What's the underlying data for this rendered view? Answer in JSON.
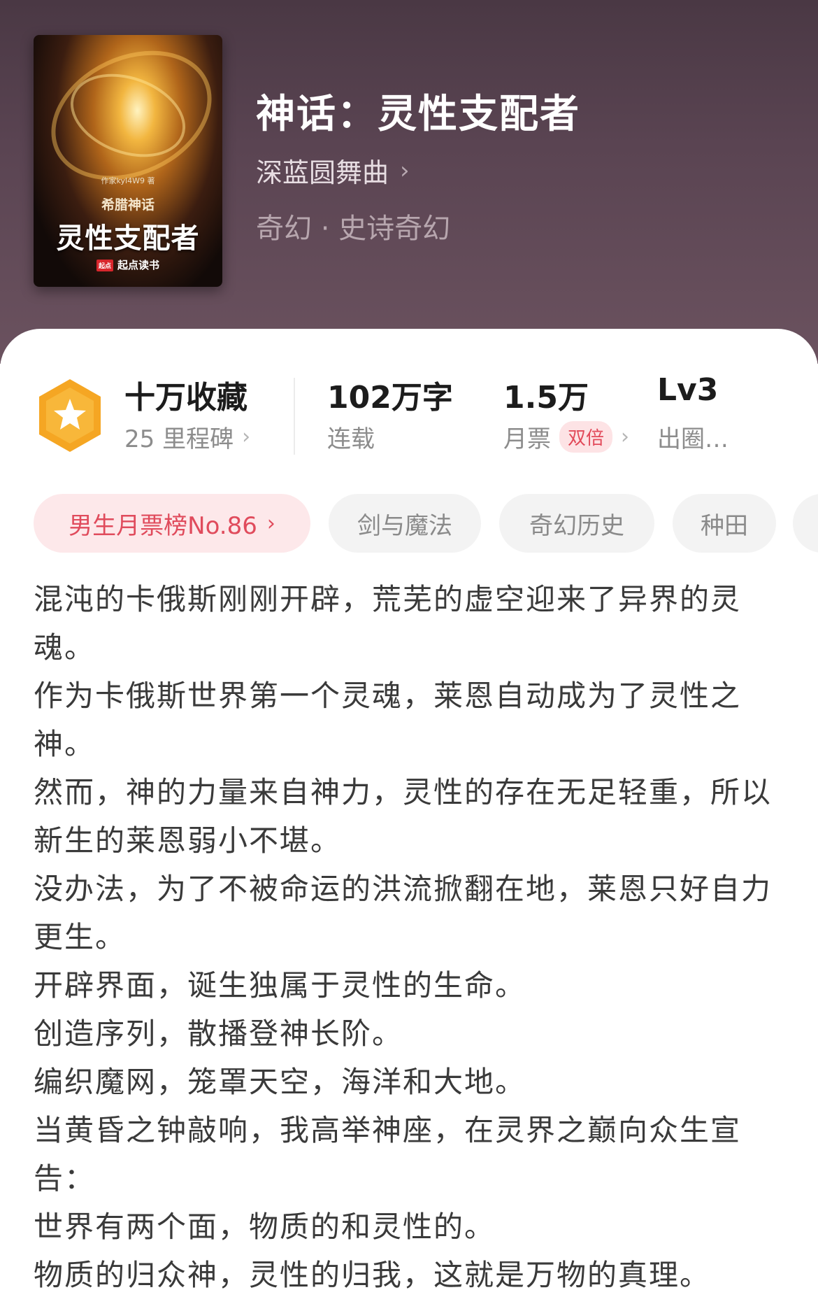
{
  "book": {
    "title": "神话：灵性支配者",
    "author": "深蓝圆舞曲",
    "genre": "奇幻 · 史诗奇幻",
    "cover": {
      "author_line": "作家kyl4W9 著",
      "series": "希腊神话",
      "title": "灵性支配者",
      "publisher": "起点读书",
      "publisher_badge": "起点"
    }
  },
  "stats": {
    "collection": {
      "value": "十万收藏",
      "sub": "25 里程碑"
    },
    "words": {
      "value": "102万字",
      "sub": "连载"
    },
    "votes": {
      "value": "1.5万",
      "sub": "月票",
      "badge": "双倍"
    },
    "level": {
      "value": "Lv3",
      "sub": "出圈…"
    }
  },
  "tags": [
    "男生月票榜No.86",
    "剑与魔法",
    "奇幻历史",
    "种田"
  ],
  "synopsis": [
    "混沌的卡俄斯刚刚开辟，荒芜的虚空迎来了异界的灵魂。",
    "作为卡俄斯世界第一个灵魂，莱恩自动成为了灵性之神。",
    "然而，神的力量来自神力，灵性的存在无足轻重，所以新生的莱恩弱小不堪。",
    "没办法，为了不被命运的洪流掀翻在地，莱恩只好自力更生。",
    "开辟界面，诞生独属于灵性的生命。",
    "创造序列，散播登神长阶。",
    "编织魔网，笼罩天空，海洋和大地。",
    "当黄昏之钟敲响，我高举神座，在灵界之巅向众生宣告：",
    "世界有两个面，物质的和灵性的。",
    "物质的归众神，灵性的归我，这就是万物的真理。"
  ],
  "colors": {
    "header_bg": "#5a4452",
    "accent_red": "#e04b5c",
    "medal_orange": "#f5a623"
  },
  "icons": {
    "medal": "star-medal-icon",
    "chevron": "chevron-right-icon"
  }
}
